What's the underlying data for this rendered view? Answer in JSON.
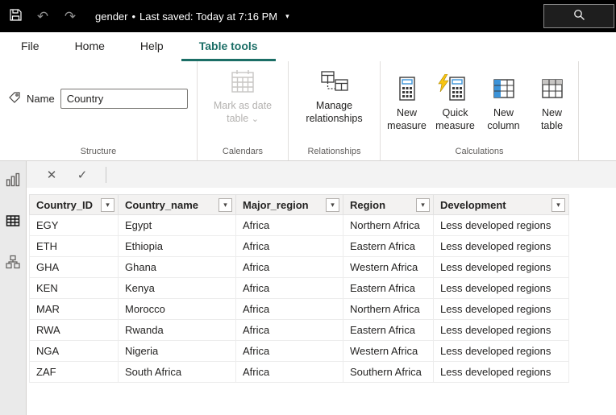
{
  "titlebar": {
    "filename": "gender",
    "separator": "•",
    "saved": "Last saved: Today at 7:16 PM"
  },
  "tabs": {
    "file": "File",
    "home": "Home",
    "help": "Help",
    "table_tools": "Table tools"
  },
  "ribbon": {
    "name_label": "Name",
    "name_value": "Country",
    "structure_group": "Structure",
    "mark_date_label": "Mark as date table",
    "calendars_group": "Calendars",
    "manage_relationships_label": "Manage relationships",
    "relationships_group": "Relationships",
    "new_measure_label": "New measure",
    "quick_measure_label": "Quick measure",
    "new_column_label": "New column",
    "new_table_label": "New table",
    "calculations_group": "Calculations"
  },
  "icons": {
    "undo": "↶",
    "redo": "↷",
    "dropdown_caret": "▾",
    "chevron_small": "⌄",
    "cancel": "✕",
    "commit": "✓"
  },
  "table": {
    "columns": [
      {
        "label": "Country_ID"
      },
      {
        "label": "Country_name"
      },
      {
        "label": "Major_region"
      },
      {
        "label": "Region"
      },
      {
        "label": "Development"
      }
    ],
    "rows": [
      [
        "EGY",
        "Egypt",
        "Africa",
        "Northern Africa",
        "Less developed regions"
      ],
      [
        "ETH",
        "Ethiopia",
        "Africa",
        "Eastern Africa",
        "Less developed regions"
      ],
      [
        "GHA",
        "Ghana",
        "Africa",
        "Western Africa",
        "Less developed regions"
      ],
      [
        "KEN",
        "Kenya",
        "Africa",
        "Eastern Africa",
        "Less developed regions"
      ],
      [
        "MAR",
        "Morocco",
        "Africa",
        "Northern Africa",
        "Less developed regions"
      ],
      [
        "RWA",
        "Rwanda",
        "Africa",
        "Eastern Africa",
        "Less developed regions"
      ],
      [
        "NGA",
        "Nigeria",
        "Africa",
        "Western Africa",
        "Less developed regions"
      ],
      [
        "ZAF",
        "South Africa",
        "Africa",
        "Southern Africa",
        "Less developed regions"
      ]
    ]
  },
  "colors": {
    "accent_teal": "#1b6e66",
    "quick_measure_yellow": "#f8c512",
    "icon_blue": "#3b93d9",
    "titlebar_bg": "#000000"
  }
}
